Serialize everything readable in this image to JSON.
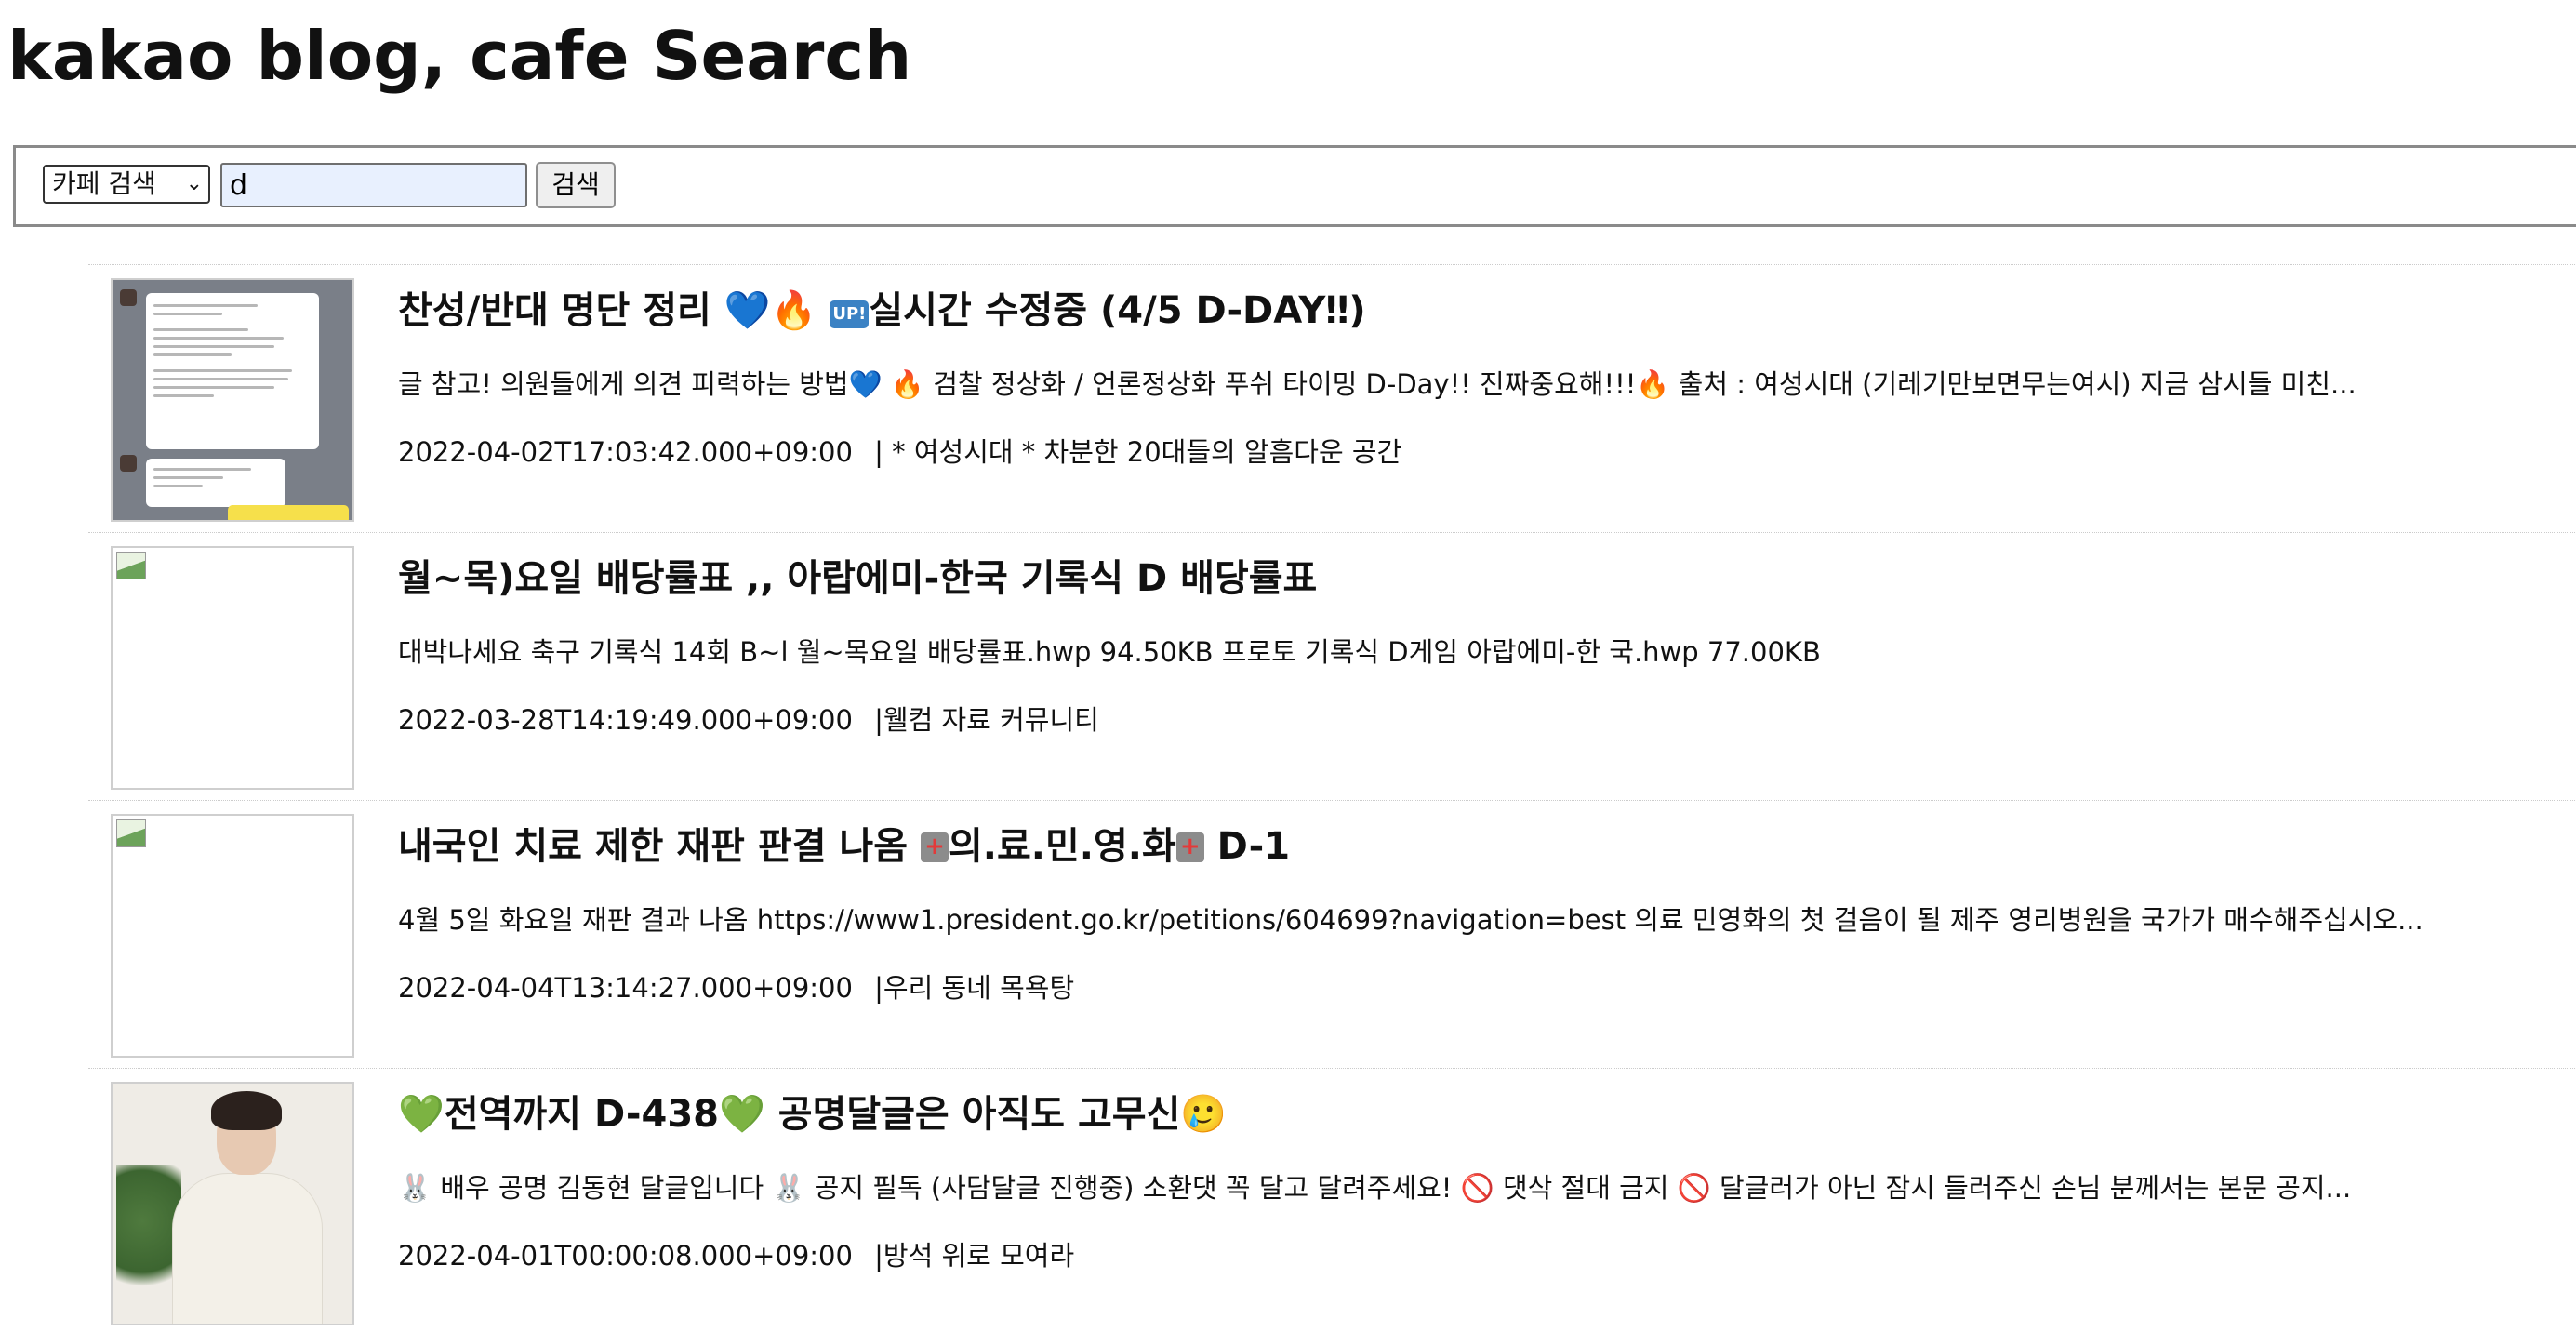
{
  "page": {
    "title": "kakao blog, cafe Search"
  },
  "search": {
    "category_selected": "카페 검색",
    "category_chevron": "⌄",
    "query_value": "d",
    "button_label": "검색"
  },
  "colors": {
    "input_autofill_bg": "#e8f0fe",
    "button_bg": "#efefef",
    "blue_heart": "#1e88e5",
    "green_heart": "#2ca02c"
  },
  "results": [
    {
      "title_a": "찬성/반대 명단 정리 ",
      "title_icons": "💙🔥",
      "title_badge": "UP!",
      "title_b": "실시간 수정중 (4/5 D-DAY‼︎)",
      "snippet": "글 참고! 의원들에게 의견 피력하는 방법💙 🔥 검찰 정상화 / 언론정상화 푸쉬 타이밍 D-Day!! 진짜중요해!!!🔥 출처 : 여성시대 (기레기만보면무는여시) 지금 삼시들 미친...",
      "datetime": "2022-04-02T17:03:42.000+09:00",
      "cafe": "| * 여성시대 *  차분한 20대들의 알흠다운 공간",
      "thumb": "chat-screenshot"
    },
    {
      "title": "월~목)요일 배당률표 ,, 아랍에미-한국 기록식 D 배당률표",
      "snippet": "대박나세요 축구 기록식 14회 B~l 월~목요일 배당률표.hwp 94.50KB 프로토 기록식 D게임 아랍에미-한 국.hwp 77.00KB",
      "datetime": "2022-03-28T14:19:49.000+09:00",
      "cafe": "|웰컴 자료 커뮤니티",
      "thumb": "broken-image"
    },
    {
      "title_a": "내국인 치료 제한 재판 판결 나옴 ",
      "title_b": "의.료.민.영.화",
      "title_c": " D-1",
      "snippet": "4월 5일 화요일 재판 결과 나옴 https://www1.president.go.kr/petitions/604699?navigation=best 의료 민영화의 첫 걸음이 될 제주 영리병원을 국가가 매수해주십시오...",
      "datetime": "2022-04-04T13:14:27.000+09:00",
      "cafe": "|우리 동네 목욕탕",
      "thumb": "broken-image"
    },
    {
      "title_heart": "💚",
      "title_a": "전역까지 D-438",
      "title_b": " 공명달글은 아직도 고무신",
      "title_face": "🥲",
      "snippet": "🐰 배우 공명 김동현 달글입니다 🐰 공지 필독 (사담달글 진행중) 소환댓 꼭 달고 달려주세요! 🚫 댓삭 절대 금지 🚫 달글러가 아닌 잠시 들러주신 손님 분께서는 본문 공지...",
      "datetime": "2022-04-01T00:00:08.000+09:00",
      "cafe": "|방석 위로 모여라",
      "thumb": "person-photo"
    }
  ]
}
